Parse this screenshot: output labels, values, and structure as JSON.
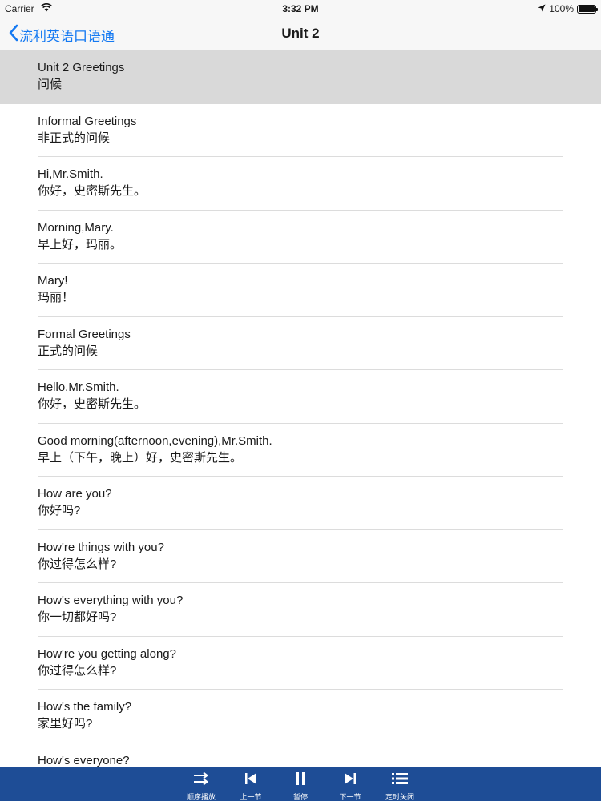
{
  "status_bar": {
    "carrier": "Carrier",
    "time": "3:32 PM",
    "battery": "100%"
  },
  "nav": {
    "back_label": "流利英语口语通",
    "title": "Unit 2"
  },
  "list": {
    "items": [
      {
        "en": "Unit 2 Greetings",
        "zh": "问候"
      },
      {
        "en": "Informal Greetings",
        "zh": "非正式的问候"
      },
      {
        "en": "Hi,Mr.Smith.",
        "zh": "你好，史密斯先生。"
      },
      {
        "en": "Morning,Mary.",
        "zh": "早上好，玛丽。"
      },
      {
        "en": "Mary!",
        "zh": "玛丽！"
      },
      {
        "en": "Formal Greetings",
        "zh": "正式的问候"
      },
      {
        "en": "Hello,Mr.Smith.",
        "zh": "你好，史密斯先生。"
      },
      {
        "en": "Good morning(afternoon,evening),Mr.Smith.",
        "zh": "早上（下午，晚上）好，史密斯先生。"
      },
      {
        "en": "How are you?",
        "zh": "你好吗?"
      },
      {
        "en": "How're things with you?",
        "zh": "你过得怎么样?"
      },
      {
        "en": "How's everything with you?",
        "zh": "你一切都好吗?"
      },
      {
        "en": "How're you getting along?",
        "zh": "你过得怎么样?"
      },
      {
        "en": "How's the family?",
        "zh": "家里好吗?"
      },
      {
        "en": "How's everyone?",
        "zh": ""
      }
    ]
  },
  "toolbar": {
    "items": [
      {
        "label": "顺序播放",
        "icon": "sequential-play-icon"
      },
      {
        "label": "上一节",
        "icon": "previous-icon"
      },
      {
        "label": "暂停",
        "icon": "pause-icon"
      },
      {
        "label": "下一节",
        "icon": "next-icon"
      },
      {
        "label": "定时关闭",
        "icon": "timer-list-icon"
      }
    ]
  },
  "colors": {
    "accent": "#1479f2",
    "toolbar_bg": "#1e4d96",
    "selected_row": "#d9d9d9"
  }
}
